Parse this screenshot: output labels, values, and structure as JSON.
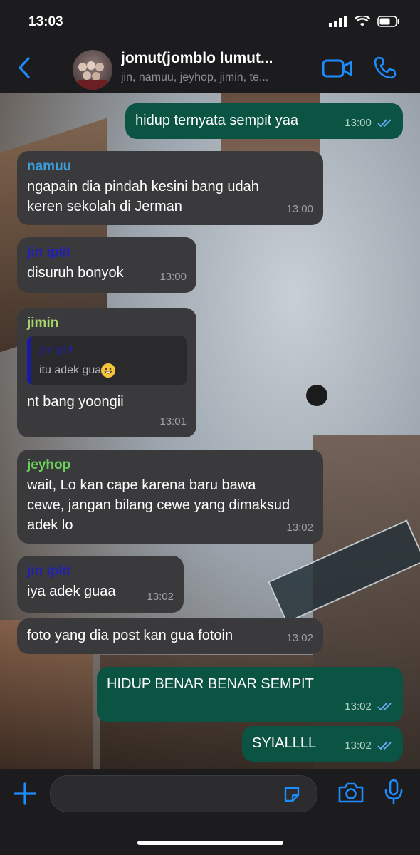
{
  "status": {
    "time": "13:03"
  },
  "header": {
    "title": "jomut(jomblo lumut...",
    "members": "jin, namuu, jeyhop, jimin, te..."
  },
  "colors": {
    "accent": "#1c8cff",
    "outgoing": "#0b5343",
    "incoming": "#3a3a3c"
  },
  "messages": [
    {
      "dir": "out",
      "text": "hidup ternyata sempit yaa",
      "time": "13:00"
    },
    {
      "dir": "in",
      "sender": "namuu",
      "sender_color": "#3aa0e0",
      "text": "ngapain dia pindah kesini bang udah keren sekolah di Jerman",
      "time": "13:00"
    },
    {
      "dir": "in",
      "sender": "jin iplit",
      "sender_color": "#2020b8",
      "text": "disuruh bonyok",
      "time": "13:00"
    },
    {
      "dir": "in",
      "sender": "jimin",
      "sender_color": "#a6d46a",
      "quote_sender": "jin iplit",
      "quote_text": "itu adek gua",
      "text": "nt bang yoongii",
      "time": "13:01"
    },
    {
      "dir": "in",
      "sender": "jeyhop",
      "sender_color": "#6bd15b",
      "text": "wait, Lo kan cape karena baru bawa cewe, jangan bilang cewe yang dimaksud adek lo",
      "time": "13:02"
    },
    {
      "dir": "in",
      "sender": "jin iplit",
      "sender_color": "#2020b8",
      "text": "iya adek guaa",
      "time": "13:02"
    },
    {
      "dir": "in",
      "text": "foto yang dia post kan gua fotoin",
      "time": "13:02"
    },
    {
      "dir": "out",
      "text": "HIDUP BENAR BENAR SEMPIT",
      "time": "13:02"
    },
    {
      "dir": "out",
      "text": "SYIALLLL",
      "time": "13:02"
    }
  ]
}
